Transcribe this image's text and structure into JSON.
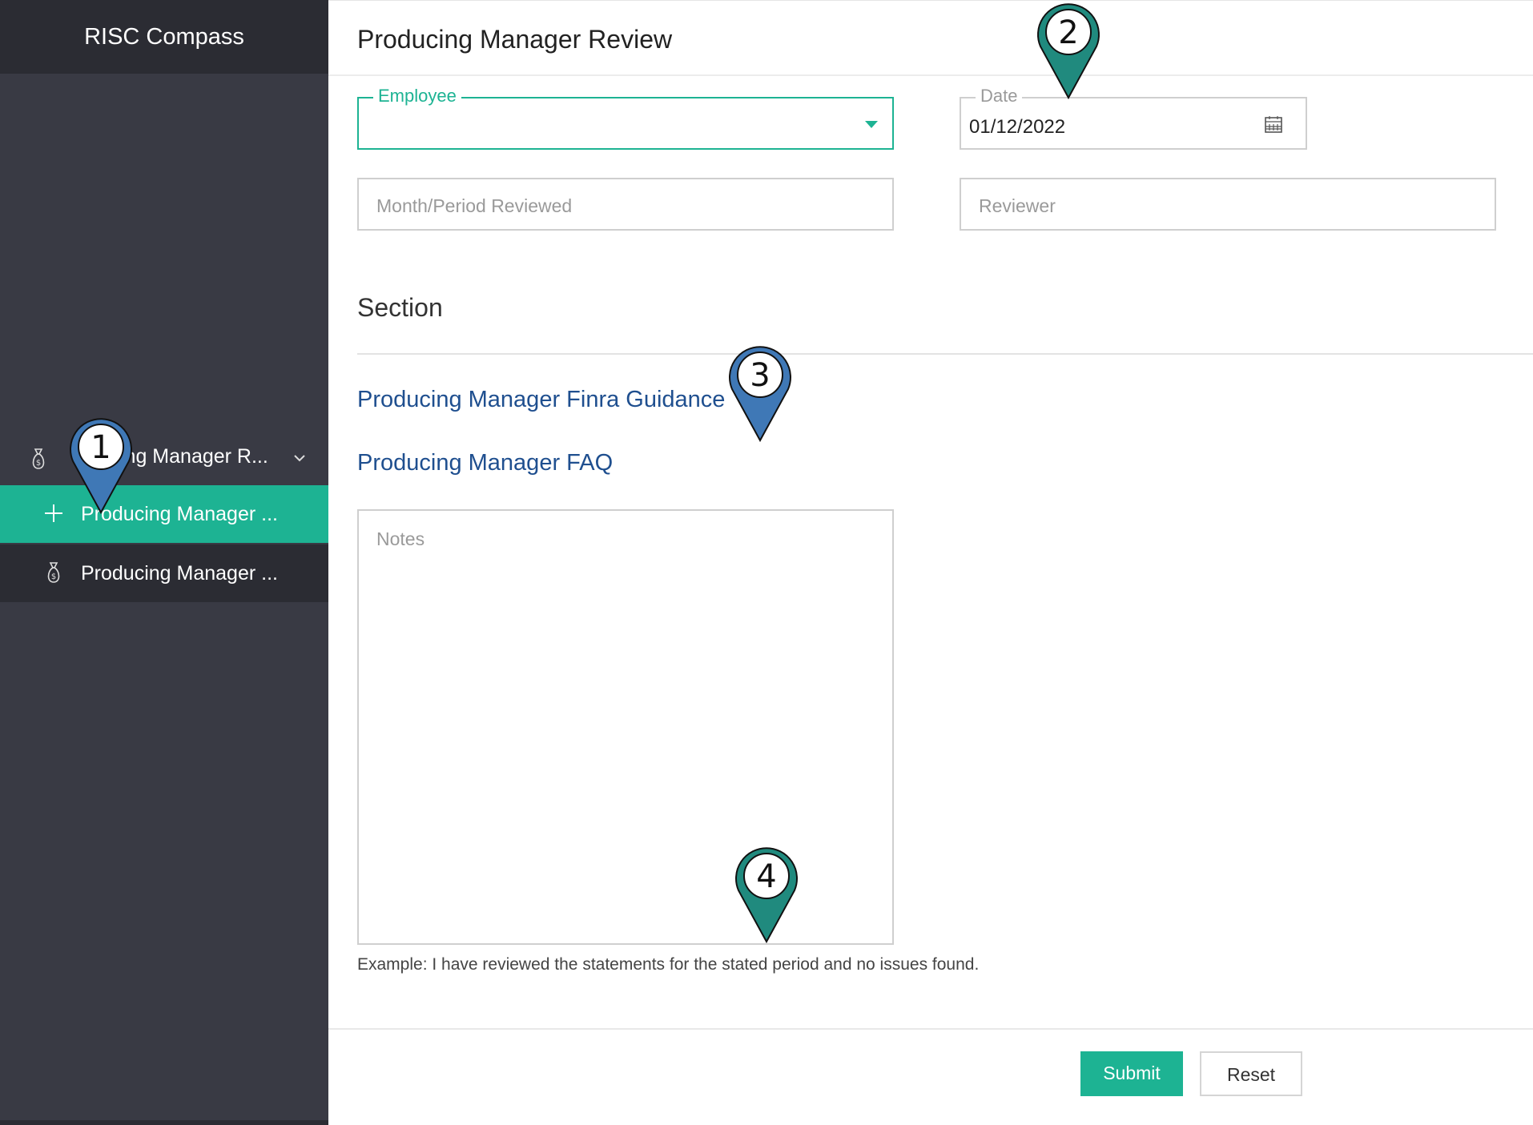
{
  "app": {
    "title": "RISC Compass"
  },
  "sidebar": {
    "group": {
      "label": "ing Manager R..."
    },
    "items": [
      {
        "label": "Producing Manager ..."
      },
      {
        "label": "Producing Manager ..."
      }
    ]
  },
  "page": {
    "title": "Producing Manager Review"
  },
  "form": {
    "employee": {
      "label": "Employee",
      "value": ""
    },
    "date": {
      "label": "Date",
      "value": "01/12/2022"
    },
    "month": {
      "placeholder": "Month/Period Reviewed"
    },
    "reviewer": {
      "placeholder": "Reviewer"
    },
    "section_title": "Section",
    "links": [
      {
        "label": "Producing Manager Finra Guidance"
      },
      {
        "label": "Producing Manager FAQ"
      }
    ],
    "notes": {
      "placeholder": "Notes",
      "helper": "Example: I have reviewed the statements for the stated period and no issues found."
    }
  },
  "buttons": {
    "submit": "Submit",
    "reset": "Reset"
  },
  "markers": [
    {
      "num": "1",
      "color": "#3f78b6"
    },
    {
      "num": "2",
      "color": "#208a7e"
    },
    {
      "num": "3",
      "color": "#3f78b6"
    },
    {
      "num": "4",
      "color": "#208a7e"
    }
  ]
}
